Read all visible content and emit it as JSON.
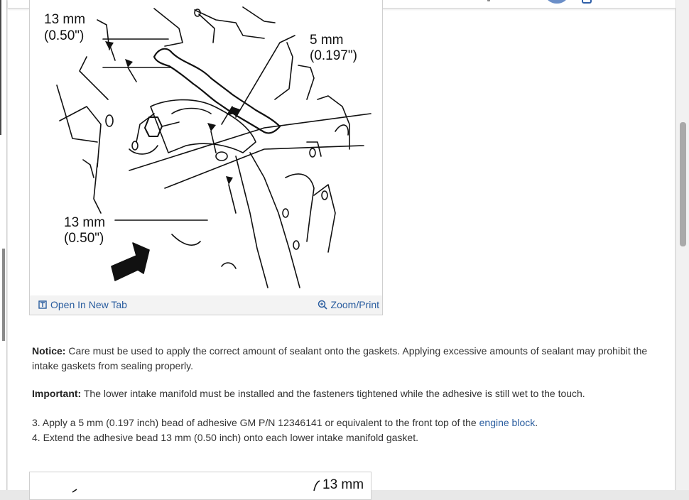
{
  "topbar": {
    "avatar_icon": "user-avatar",
    "account_icon": "account-icon"
  },
  "figure1": {
    "labels": {
      "top_left_mm": "13 mm",
      "top_left_in": "(0.50\")",
      "top_right_mm": "5 mm",
      "top_right_in": "(0.197\")",
      "bottom_left_mm": "13 mm",
      "bottom_left_in": "(0.50\")"
    },
    "open_new_tab": "Open In New Tab",
    "zoom_print": "Zoom/Print"
  },
  "notice": {
    "label": "Notice:",
    "text": " Care must be used to apply the correct amount of sealant onto the gaskets. Applying excessive amounts of sealant may prohibit the intake gaskets from sealing properly."
  },
  "important": {
    "label": "Important:",
    "text": " The lower intake manifold must be installed and the fasteners tightened while the adhesive is still wet to the touch."
  },
  "steps": {
    "step3_prefix": "3. Apply a 5 mm (0.197 inch) bead of adhesive GM P/N 12346141 or equivalent to the front top of the ",
    "step3_link": "engine block",
    "step3_suffix": ".",
    "step4": "4. Extend the adhesive bead 13 mm (0.50 inch) onto each lower intake manifold gasket."
  },
  "figure2": {
    "label_mm": "13 mm"
  },
  "colors": {
    "link": "#2a5d9f",
    "avatar": "#6b8fc8"
  }
}
